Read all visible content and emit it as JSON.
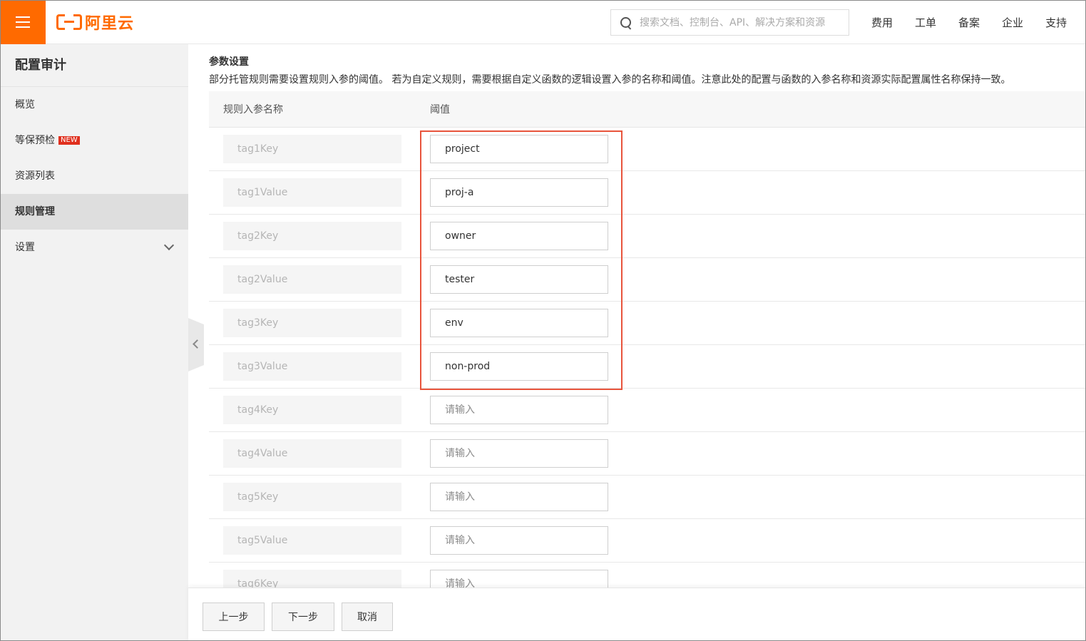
{
  "topbar": {
    "logo_text": "阿里云",
    "search_placeholder": "搜索文档、控制台、API、解决方案和资源",
    "nav": [
      "费用",
      "工单",
      "备案",
      "企业",
      "支持"
    ]
  },
  "sidebar": {
    "title": "配置审计",
    "items": [
      {
        "label": "概览"
      },
      {
        "label": "等保预检",
        "badge": "NEW"
      },
      {
        "label": "资源列表"
      },
      {
        "label": "规则管理",
        "active": true
      },
      {
        "label": "设置"
      }
    ]
  },
  "params": {
    "title": "参数设置",
    "description": "部分托管规则需要设置规则入参的阈值。 若为自定义规则，需要根据自定义函数的逻辑设置入参的名称和阈值。注意此处的配置与函数的入参名称和资源实际配置属性名称保持一致。",
    "col_name": "规则入参名称",
    "col_value": "阈值",
    "input_placeholder": "请输入",
    "rows": [
      {
        "name": "tag1Key",
        "value": "project"
      },
      {
        "name": "tag1Value",
        "value": "proj-a"
      },
      {
        "name": "tag2Key",
        "value": "owner"
      },
      {
        "name": "tag2Value",
        "value": "tester"
      },
      {
        "name": "tag3Key",
        "value": "env"
      },
      {
        "name": "tag3Value",
        "value": "non-prod"
      },
      {
        "name": "tag4Key",
        "value": ""
      },
      {
        "name": "tag4Value",
        "value": ""
      },
      {
        "name": "tag5Key",
        "value": ""
      },
      {
        "name": "tag5Value",
        "value": ""
      },
      {
        "name": "tag6Key",
        "value": ""
      }
    ]
  },
  "footer": {
    "prev_label": "上一步",
    "next_label": "下一步",
    "cancel_label": "取消"
  },
  "colors": {
    "brand": "#ff6a00",
    "highlight": "#e8543c",
    "badge": "#e0301e"
  }
}
